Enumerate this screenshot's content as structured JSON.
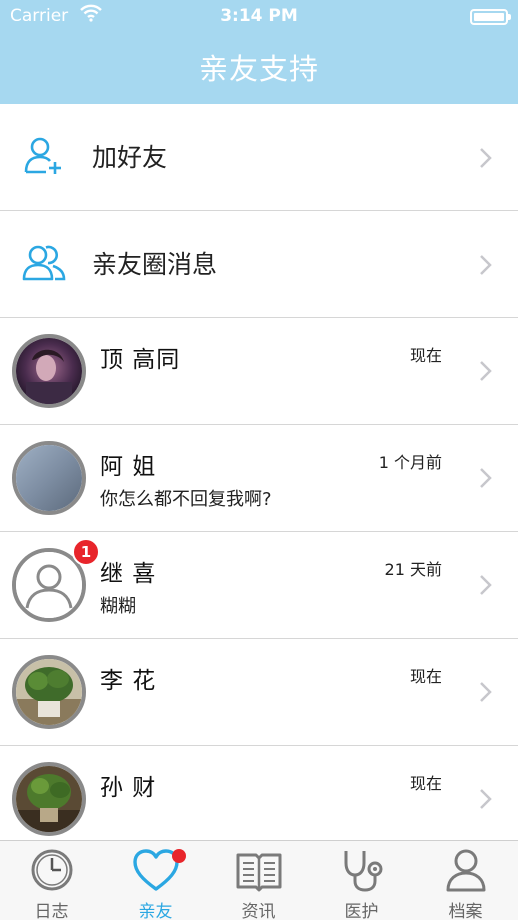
{
  "status_bar": {
    "carrier": "Carrier",
    "time": "3:14 PM"
  },
  "header": {
    "title": "亲友支持"
  },
  "menu": [
    {
      "label": "加好友",
      "icon": "add-user-icon"
    },
    {
      "label": "亲友圈消息",
      "icon": "group-icon"
    }
  ],
  "friends": [
    {
      "name": "顶 高同",
      "time": "现在",
      "message": "",
      "badge": ""
    },
    {
      "name": "阿 姐",
      "time": "1 个月前",
      "message": "你怎么都不回复我啊?",
      "badge": ""
    },
    {
      "name": "继 喜",
      "time": "21 天前",
      "message": "糊糊",
      "badge": "1"
    },
    {
      "name": "李 花",
      "time": "现在",
      "message": "",
      "badge": ""
    },
    {
      "name": "孙 财",
      "time": "现在",
      "message": "",
      "badge": ""
    }
  ],
  "tabs": [
    {
      "label": "日志",
      "icon": "clock-icon",
      "active": false
    },
    {
      "label": "亲友",
      "icon": "heart-icon",
      "active": true
    },
    {
      "label": "资讯",
      "icon": "book-icon",
      "active": false
    },
    {
      "label": "医护",
      "icon": "stethoscope-icon",
      "active": false
    },
    {
      "label": "档案",
      "icon": "profile-icon",
      "active": false
    }
  ],
  "colors": {
    "header": "#a6d8f0",
    "accent": "#2ba7e2",
    "badge": "#e8252b"
  }
}
